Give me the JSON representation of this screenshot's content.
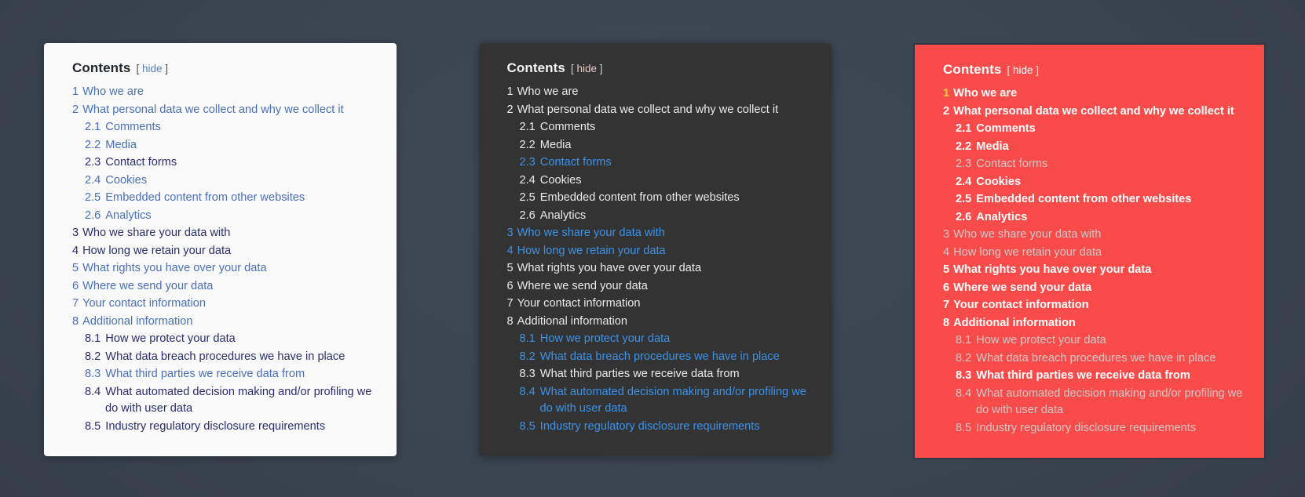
{
  "page": {
    "background_color": "#3b4552"
  },
  "panels": [
    {
      "name": "light",
      "theme": "theme-light",
      "background_color": "#fafafa",
      "title": "Contents",
      "hide_open": "[",
      "hide_label": "hide",
      "hide_close": "]",
      "items": [
        {
          "num": "1",
          "text": "Who we are",
          "level": 1,
          "state": "a"
        },
        {
          "num": "2",
          "text": "What personal data we collect and why we collect it",
          "level": 1,
          "state": "a"
        },
        {
          "num": "2.1",
          "text": "Comments",
          "level": 2,
          "state": "a"
        },
        {
          "num": "2.2",
          "text": "Media",
          "level": 2,
          "state": "a"
        },
        {
          "num": "2.3",
          "text": "Contact forms",
          "level": 2,
          "state": "b"
        },
        {
          "num": "2.4",
          "text": "Cookies",
          "level": 2,
          "state": "a"
        },
        {
          "num": "2.5",
          "text": "Embedded content from other websites",
          "level": 2,
          "state": "a"
        },
        {
          "num": "2.6",
          "text": "Analytics",
          "level": 2,
          "state": "a"
        },
        {
          "num": "3",
          "text": "Who we share your data with",
          "level": 1,
          "state": "b"
        },
        {
          "num": "4",
          "text": "How long we retain your data",
          "level": 1,
          "state": "b"
        },
        {
          "num": "5",
          "text": "What rights you have over your data",
          "level": 1,
          "state": "a"
        },
        {
          "num": "6",
          "text": "Where we send your data",
          "level": 1,
          "state": "a"
        },
        {
          "num": "7",
          "text": "Your contact information",
          "level": 1,
          "state": "a"
        },
        {
          "num": "8",
          "text": "Additional information",
          "level": 1,
          "state": "a"
        },
        {
          "num": "8.1",
          "text": "How we protect your data",
          "level": 2,
          "state": "b"
        },
        {
          "num": "8.2",
          "text": "What data breach procedures we have in place",
          "level": 2,
          "state": "b"
        },
        {
          "num": "8.3",
          "text": "What third parties we receive data from",
          "level": 2,
          "state": "a"
        },
        {
          "num": "8.4",
          "text": "What automated decision making and/or profiling we do with user data",
          "level": 2,
          "state": "b"
        },
        {
          "num": "8.5",
          "text": "Industry regulatory disclosure requirements",
          "level": 2,
          "state": "b"
        }
      ]
    },
    {
      "name": "dark",
      "theme": "theme-dark",
      "background_color": "#333333",
      "title": "Contents",
      "hide_open": "[",
      "hide_label": "hide",
      "hide_close": "]",
      "items": [
        {
          "num": "1",
          "text": "Who we are",
          "level": 1,
          "state": "a"
        },
        {
          "num": "2",
          "text": "What personal data we collect and why we collect it",
          "level": 1,
          "state": "a"
        },
        {
          "num": "2.1",
          "text": "Comments",
          "level": 2,
          "state": "a"
        },
        {
          "num": "2.2",
          "text": "Media",
          "level": 2,
          "state": "a"
        },
        {
          "num": "2.3",
          "text": "Contact forms",
          "level": 2,
          "state": "b"
        },
        {
          "num": "2.4",
          "text": "Cookies",
          "level": 2,
          "state": "a"
        },
        {
          "num": "2.5",
          "text": "Embedded content from other websites",
          "level": 2,
          "state": "a"
        },
        {
          "num": "2.6",
          "text": "Analytics",
          "level": 2,
          "state": "a"
        },
        {
          "num": "3",
          "text": "Who we share your data with",
          "level": 1,
          "state": "b"
        },
        {
          "num": "4",
          "text": "How long we retain your data",
          "level": 1,
          "state": "b"
        },
        {
          "num": "5",
          "text": "What rights you have over your data",
          "level": 1,
          "state": "a"
        },
        {
          "num": "6",
          "text": "Where we send your data",
          "level": 1,
          "state": "a"
        },
        {
          "num": "7",
          "text": "Your contact information",
          "level": 1,
          "state": "a"
        },
        {
          "num": "8",
          "text": "Additional information",
          "level": 1,
          "state": "a"
        },
        {
          "num": "8.1",
          "text": "How we protect your data",
          "level": 2,
          "state": "b"
        },
        {
          "num": "8.2",
          "text": "What data breach procedures we have in place",
          "level": 2,
          "state": "b"
        },
        {
          "num": "8.3",
          "text": "What third parties we receive data from",
          "level": 2,
          "state": "a"
        },
        {
          "num": "8.4",
          "text": "What automated decision making and/or profiling we do with user data",
          "level": 2,
          "state": "b"
        },
        {
          "num": "8.5",
          "text": "Industry regulatory disclosure requirements",
          "level": 2,
          "state": "b"
        }
      ]
    },
    {
      "name": "red",
      "theme": "theme-red",
      "background_color": "#fa4b4b",
      "title": "Contents",
      "hide_open": "[",
      "hide_label": "hide",
      "hide_close": "]",
      "items": [
        {
          "num": "1",
          "text": "Who we are",
          "level": 1,
          "state": "a"
        },
        {
          "num": "2",
          "text": "What personal data we collect and why we collect it",
          "level": 1,
          "state": "a"
        },
        {
          "num": "2.1",
          "text": "Comments",
          "level": 2,
          "state": "a"
        },
        {
          "num": "2.2",
          "text": "Media",
          "level": 2,
          "state": "a"
        },
        {
          "num": "2.3",
          "text": "Contact forms",
          "level": 2,
          "state": "b"
        },
        {
          "num": "2.4",
          "text": "Cookies",
          "level": 2,
          "state": "a"
        },
        {
          "num": "2.5",
          "text": "Embedded content from other websites",
          "level": 2,
          "state": "a"
        },
        {
          "num": "2.6",
          "text": "Analytics",
          "level": 2,
          "state": "a"
        },
        {
          "num": "3",
          "text": "Who we share your data with",
          "level": 1,
          "state": "b"
        },
        {
          "num": "4",
          "text": "How long we retain your data",
          "level": 1,
          "state": "b"
        },
        {
          "num": "5",
          "text": "What rights you have over your data",
          "level": 1,
          "state": "a"
        },
        {
          "num": "6",
          "text": "Where we send your data",
          "level": 1,
          "state": "a"
        },
        {
          "num": "7",
          "text": "Your contact information",
          "level": 1,
          "state": "a"
        },
        {
          "num": "8",
          "text": "Additional information",
          "level": 1,
          "state": "a"
        },
        {
          "num": "8.1",
          "text": "How we protect your data",
          "level": 2,
          "state": "b"
        },
        {
          "num": "8.2",
          "text": "What data breach procedures we have in place",
          "level": 2,
          "state": "b"
        },
        {
          "num": "8.3",
          "text": "What third parties we receive data from",
          "level": 2,
          "state": "a"
        },
        {
          "num": "8.4",
          "text": "What automated decision making and/or profiling we do with user data",
          "level": 2,
          "state": "b"
        },
        {
          "num": "8.5",
          "text": "Industry regulatory disclosure requirements",
          "level": 2,
          "state": "b"
        }
      ]
    }
  ]
}
